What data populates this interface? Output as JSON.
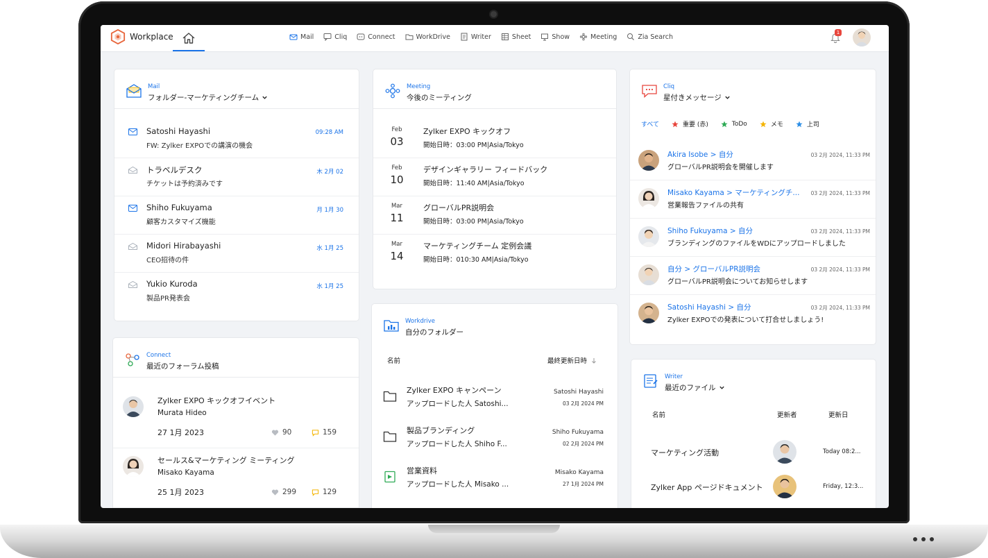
{
  "colors": {
    "accent": "#1a73e8",
    "badge": "#e8453c",
    "star_red": "#e8453c",
    "star_green": "#2eaa55",
    "star_yellow": "#f4b400",
    "star_blue": "#2b8ee6"
  },
  "topbar": {
    "brand": "Workplace",
    "nav": [
      {
        "label": "Mail",
        "icon": "mail-icon"
      },
      {
        "label": "Cliq",
        "icon": "chat-icon"
      },
      {
        "label": "Connect",
        "icon": "connect-icon"
      },
      {
        "label": "WorkDrive",
        "icon": "drive-icon"
      },
      {
        "label": "Writer",
        "icon": "writer-icon"
      },
      {
        "label": "Sheet",
        "icon": "sheet-icon"
      },
      {
        "label": "Show",
        "icon": "show-icon"
      },
      {
        "label": "Meeting",
        "icon": "meeting-icon"
      },
      {
        "label": "Zia Search",
        "icon": "search-icon"
      }
    ],
    "notification_count": "1"
  },
  "mail": {
    "app": "Mail",
    "title": "フォルダー-マーケティングチーム",
    "items": [
      {
        "from": "Satoshi Hayashi",
        "subject": "FW: Zylker EXPOでの講演の機会",
        "time": "09:28 AM"
      },
      {
        "from": "トラベルデスク",
        "subject": "チケットは予約済みです",
        "time": "木 2月 02"
      },
      {
        "from": "Shiho Fukuyama",
        "subject": "顧客カスタマイズ機能",
        "time": "月 1月 30"
      },
      {
        "from": "Midori Hirabayashi",
        "subject": "CEO招待の件",
        "time": "水 1月 25"
      },
      {
        "from": "Yukio Kuroda",
        "subject": "製品PR発表会",
        "time": "水 1月 25"
      }
    ]
  },
  "connect": {
    "app": "Connect",
    "title": "最近のフォーラム投稿",
    "posts": [
      {
        "title": "Zylker EXPO キックオフイベント",
        "author": "Murata Hideo",
        "date": "27 1月 2023",
        "likes": "90",
        "comments": "159"
      },
      {
        "title": "セールス&マーケティング ミーティング",
        "author": "Misako Kayama",
        "date": "25 1月 2023",
        "likes": "299",
        "comments": "129"
      }
    ]
  },
  "meeting": {
    "app": "Meeting",
    "title": "今後のミーティング",
    "items": [
      {
        "month": "Feb",
        "day": "03",
        "title": "Zylker EXPO キックオフ",
        "time": "開始日時：03:00 PM|Asia/Tokyo"
      },
      {
        "month": "Feb",
        "day": "10",
        "title": "デザインギャラリー フィードバック",
        "time": "開始日時：11:40 AM|Asia/Tokyo"
      },
      {
        "month": "Mar",
        "day": "11",
        "title": "グローバルPR説明会",
        "time": "開始日時：03:00 PM|Asia/Tokyo"
      },
      {
        "month": "Mar",
        "day": "14",
        "title": "マーケティングチーム 定例会議",
        "time": "開始日時：010:30 AM|Asia/Tokyo"
      }
    ]
  },
  "workdrive": {
    "app": "Workdrive",
    "title": "自分のフォルダー",
    "col_name": "名前",
    "col_modified": "最終更新日時",
    "items": [
      {
        "name": "Zylker EXPO キャンペーン",
        "sub": "アップロードした人 Satoshi...",
        "owner": "Satoshi Hayashi",
        "date": "03 2月 2024 PM",
        "icon": "folder-icon"
      },
      {
        "name": "製品ブランディング",
        "sub": "アップロードした人 Shiho F...",
        "owner": "Shiho Fukuyama",
        "date": "02 2月 2024 PM",
        "icon": "folder-icon"
      },
      {
        "name": "営業資料",
        "sub": "アップロードした人 Misako ...",
        "owner": "Misako Kayama",
        "date": "27 1月 2024 PM",
        "icon": "presentation-icon"
      }
    ]
  },
  "cliq": {
    "app": "Cliq",
    "title": "星付きメッセージ",
    "tabs": [
      {
        "label": "すべて",
        "star": ""
      },
      {
        "label": "重要 (赤)",
        "star": "red"
      },
      {
        "label": "ToDo",
        "star": "green"
      },
      {
        "label": "メモ",
        "star": "yellow"
      },
      {
        "label": "上司",
        "star": "blue"
      }
    ],
    "messages": [
      {
        "from": "Akira Isobe > 自分",
        "time": "03 2月 2024, 11:33 PM",
        "text": "グローバルPR説明会を開催します"
      },
      {
        "from": "Misako Kayama > マーケティングチ...",
        "time": "03 2月 2024, 11:33 PM",
        "text": "営業報告ファイルの共有"
      },
      {
        "from": "Shiho Fukuyama > 自分",
        "time": "03 2月 2024, 11:33 PM",
        "text": "ブランディングのファイルをWDにアップロードしました"
      },
      {
        "from": "自分 > グローバルPR説明会",
        "time": "03 2月 2024, 11:33 PM",
        "text": "グローバルPR説明会についてお知らせします"
      },
      {
        "from": "Satoshi Hayashi > 自分",
        "time": "03 2月 2024, 11:33 PM",
        "text": "Zylker EXPOでの発表について打合せしましょう!"
      }
    ]
  },
  "writer": {
    "app": "Writer",
    "title": "最近のファイル",
    "col_name": "名前",
    "col_updater": "更新者",
    "col_date": "更新日",
    "files": [
      {
        "name": "マーケティング活動",
        "date": "Today 08:2..."
      },
      {
        "name": "Zylker App ページドキュメント",
        "date": "Friday, 12:3..."
      }
    ]
  }
}
